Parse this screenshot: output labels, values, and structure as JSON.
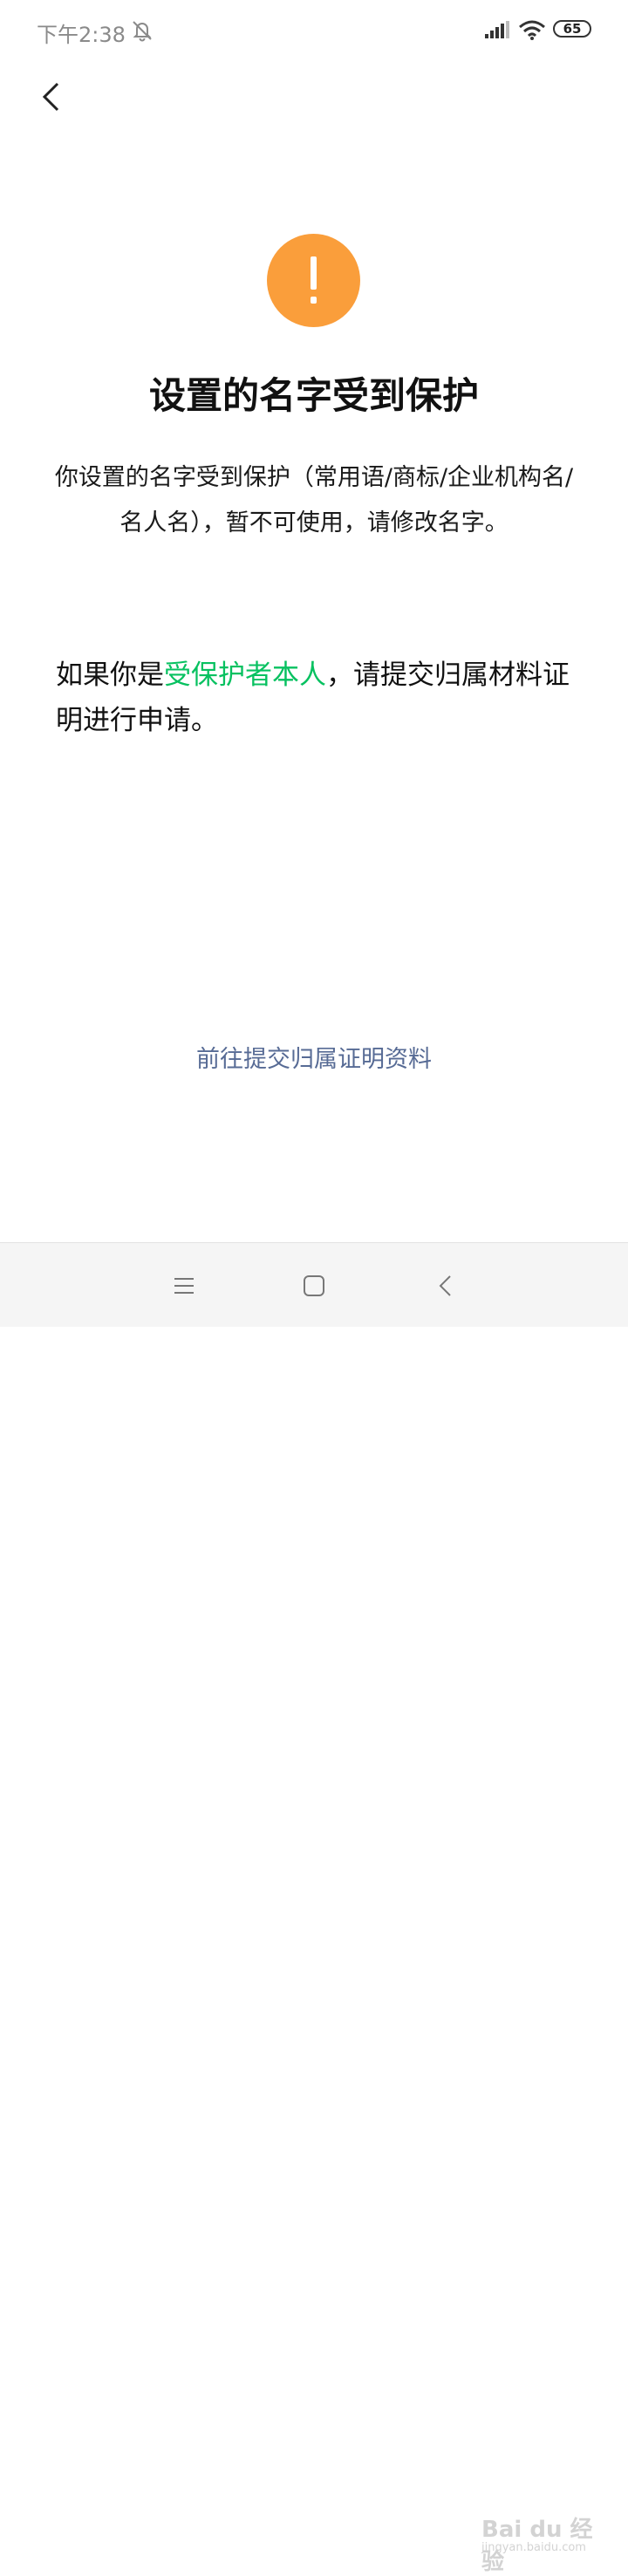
{
  "status_bar": {
    "time": "下午2:38",
    "battery": "65"
  },
  "title": "设置的名字受到保护",
  "description": "你设置的名字受到保护（常用语/商标/企业机构名/名人名），暂不可使用，请修改名字。",
  "info": {
    "prefix": "如果你是",
    "highlight": "受保护者本人",
    "suffix": "，请提交归属材料证明进行申请。"
  },
  "submit_link": "前往提交归属证明资料",
  "watermark": {
    "main": "Bai du 经验",
    "sub": "jingyan.baidu.com"
  },
  "colors": {
    "warning": "#fa9e3b",
    "highlight": "#07c160",
    "link": "#576b95"
  }
}
